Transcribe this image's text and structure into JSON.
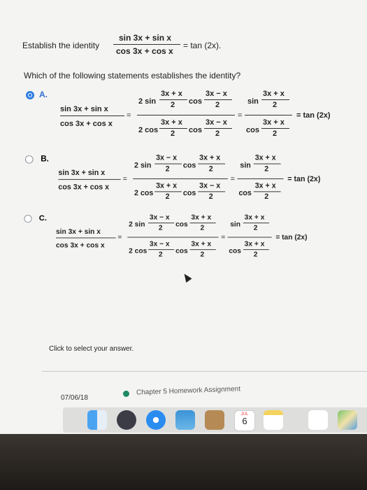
{
  "prompt": {
    "establish": "Establish the identity",
    "num": "sin 3x + sin x",
    "den": "cos 3x + cos x",
    "rhs": "= tan (2x)."
  },
  "question": "Which of the following statements establishes the identity?",
  "options": [
    {
      "letter": "A.",
      "selected": true,
      "lhs_num": "sin 3x + sin x",
      "lhs_den": "cos 3x + cos x",
      "mid_num": {
        "coef": "2 sin",
        "a_top": "3x + x",
        "a_bot": "2",
        "func": "cos",
        "b_top": "3x − x",
        "b_bot": "2"
      },
      "mid_den": {
        "coef": "2 cos",
        "a_top": "3x + x",
        "a_bot": "2",
        "func": "cos",
        "b_top": "3x − x",
        "b_bot": "2"
      },
      "r_num": {
        "func": "sin",
        "top": "3x + x",
        "bot": "2"
      },
      "r_den": {
        "func": "cos",
        "top": "3x + x",
        "bot": "2"
      },
      "result": "= tan (2x)"
    },
    {
      "letter": "B.",
      "selected": false,
      "lhs_num": "sin 3x + sin x",
      "lhs_den": "cos 3x + cos x",
      "mid_num": {
        "coef": "2 sin",
        "a_top": "3x − x",
        "a_bot": "2",
        "func": "cos",
        "b_top": "3x + x",
        "b_bot": "2"
      },
      "mid_den": {
        "coef": "2 cos",
        "a_top": "3x + x",
        "a_bot": "2",
        "func": "cos",
        "b_top": "3x − x",
        "b_bot": "2"
      },
      "r_num": {
        "func": "sin",
        "top": "3x + x",
        "bot": "2"
      },
      "r_den": {
        "func": "cos",
        "top": "3x + x",
        "bot": "2"
      },
      "result": "= tan (2x)"
    },
    {
      "letter": "C.",
      "selected": false,
      "lhs_num": "sin 3x + sin x",
      "lhs_den": "cos 3x + cos x",
      "mid_num": {
        "coef": "2 sin",
        "a_top": "3x − x",
        "a_bot": "2",
        "func": "cos",
        "b_top": "3x + x",
        "b_bot": "2"
      },
      "mid_den": {
        "coef": "2 cos",
        "a_top": "3x − x",
        "a_bot": "2",
        "func": "cos",
        "b_top": "3x + x",
        "b_bot": "2"
      },
      "r_num": {
        "func": "sin",
        "top": "3x + x",
        "bot": "2"
      },
      "r_den": {
        "func": "cos",
        "top": "3x + x",
        "bot": "2"
      },
      "result": "= tan (2x)"
    }
  ],
  "footer": {
    "hint": "Click to select your answer.",
    "date": "07/06/18",
    "assignment": "Chapter 5 Homework Assignment"
  },
  "dock": {
    "calendar_month": "JUL",
    "calendar_day": "6"
  },
  "colors": {
    "accent": "#2f7de1",
    "screen_bg": "#f4f4f2"
  }
}
